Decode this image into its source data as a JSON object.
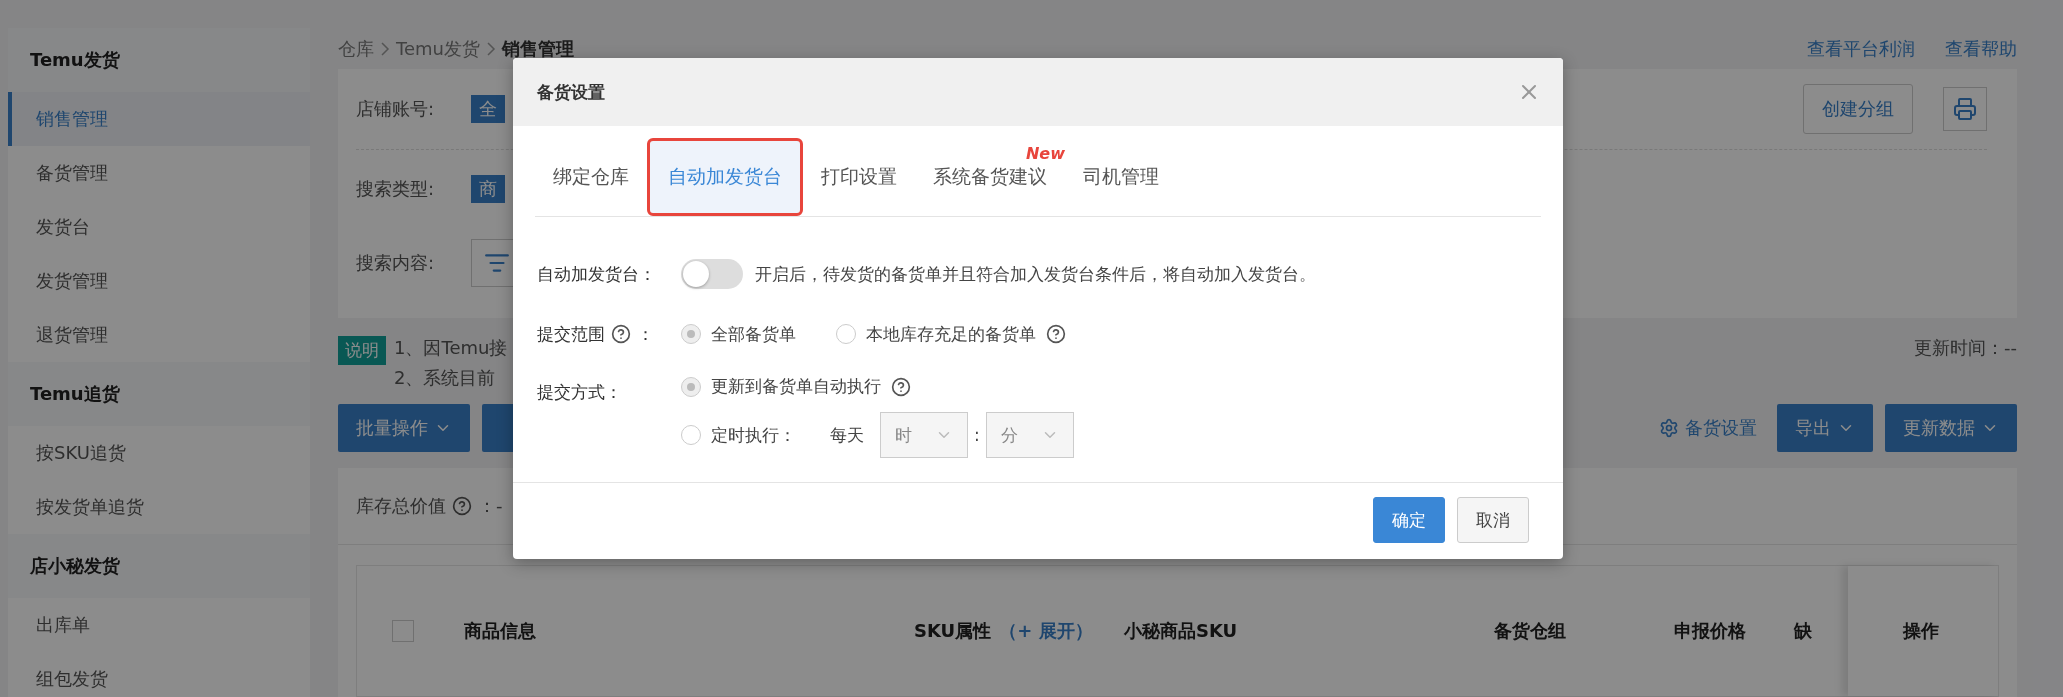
{
  "sidebar": {
    "groups": [
      {
        "title": "Temu发货",
        "items": [
          {
            "label": "销售管理",
            "selected": true
          },
          {
            "label": "备货管理",
            "selected": false
          },
          {
            "label": "发货台",
            "selected": false
          },
          {
            "label": "发货管理",
            "selected": false
          },
          {
            "label": "退货管理",
            "selected": false
          }
        ]
      },
      {
        "title": "Temu追货",
        "items": [
          {
            "label": "按SKU追货",
            "selected": false
          },
          {
            "label": "按发货单追货",
            "selected": false
          }
        ]
      },
      {
        "title": "店小秘发货",
        "items": [
          {
            "label": "出库单",
            "selected": false
          },
          {
            "label": "组包发货",
            "selected": false
          }
        ]
      }
    ]
  },
  "breadcrumb": [
    "仓库",
    "Temu发货",
    "销售管理"
  ],
  "header_links": [
    "查看平台利润",
    "查看帮助"
  ],
  "filters": [
    {
      "label": "店铺账号:",
      "value": "全"
    },
    {
      "label": "搜索类型:",
      "value": "商"
    },
    {
      "label": "搜索内容:"
    }
  ],
  "create_group_button": "创建分组",
  "notice": {
    "badge": "说明",
    "lines": [
      "1、因Temu接",
      "2、系统目前"
    ]
  },
  "update_time": "更新时间：--",
  "toolbar": {
    "left": [
      {
        "label": "批量操作",
        "dropdown": true
      },
      {
        "dropdown": false
      }
    ],
    "settings_link": "备货设置",
    "right": [
      {
        "label": "导出",
        "dropdown": true
      },
      {
        "label": "更新数据",
        "dropdown": true
      }
    ]
  },
  "summary": {
    "label": "库存总价值",
    "colon": "：",
    "value": "-"
  },
  "table": {
    "select_all_checked": false,
    "columns": [
      {
        "label": "商品信息"
      },
      {
        "label": "SKU属性",
        "action": "（+ 展开）"
      },
      {
        "label": "小秘商品SKU"
      },
      {
        "label": "备货仓组"
      },
      {
        "label": "申报价格"
      },
      {
        "label": "缺"
      },
      {
        "label": "操作"
      }
    ]
  },
  "modal": {
    "title": "备货设置",
    "tabs": [
      {
        "label": "绑定仓库",
        "selected": false
      },
      {
        "label": "自动加发货台",
        "selected": true
      },
      {
        "label": "打印设置",
        "selected": false
      },
      {
        "label": "系统备货建议",
        "selected": false,
        "badge": "New"
      },
      {
        "label": "司机管理",
        "selected": false
      }
    ],
    "auto_add": {
      "label": "自动加发货台：",
      "on": false,
      "description": "开启后，待发货的备货单并且符合加入发货台条件后，将自动加入发货台。"
    },
    "scope": {
      "label": "提交范围",
      "suffix": "：",
      "options": [
        {
          "label": "全部备货单",
          "selected": true,
          "help": false
        },
        {
          "label": "本地库存充足的备货单",
          "selected": false,
          "help": true
        }
      ]
    },
    "mode": {
      "label": "提交方式：",
      "options": [
        {
          "label": "更新到备货单自动执行",
          "selected": true,
          "help": true
        },
        {
          "label": "定时执行：",
          "selected": false,
          "help": false,
          "schedule": {
            "prefix": "每天",
            "hour": "时",
            "separator": ":",
            "minute": "分"
          }
        }
      ]
    },
    "buttons": [
      {
        "label": "确定",
        "kind": "primary"
      },
      {
        "label": "取消",
        "kind": "default"
      }
    ]
  }
}
